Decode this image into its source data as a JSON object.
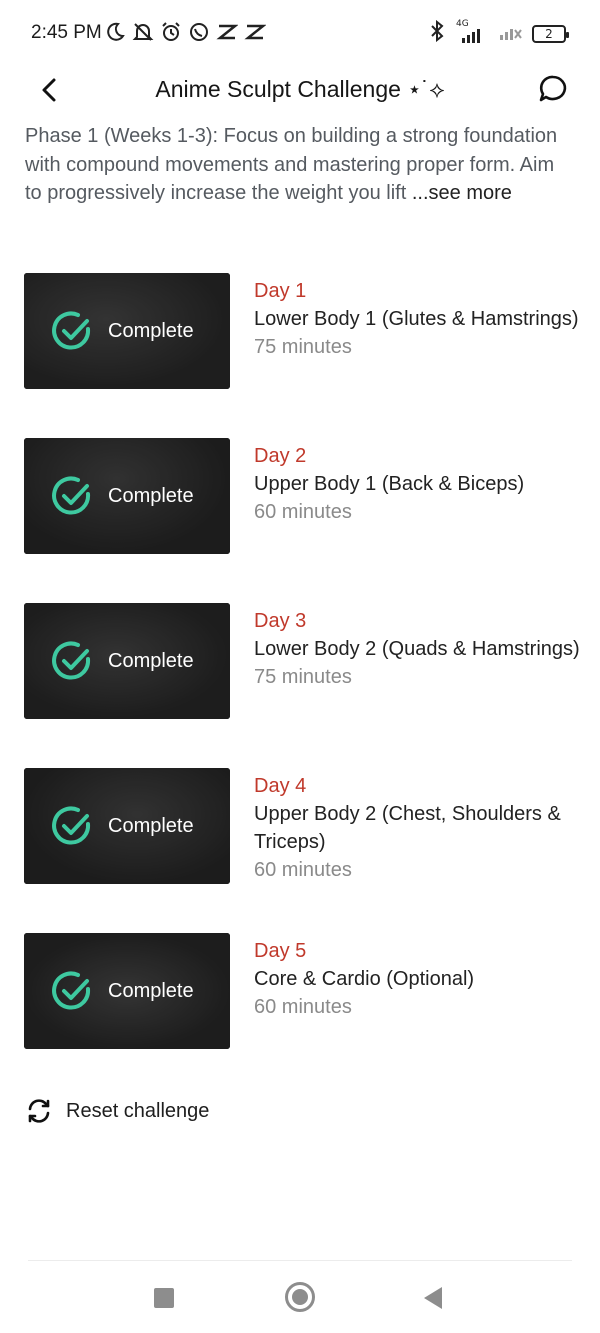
{
  "status_bar": {
    "time": "2:45 PM",
    "network": "4G",
    "battery": "2",
    "icons_left": [
      "moon-icon",
      "muted-bell-icon",
      "alarm-icon",
      "whatsapp-icon",
      "capcut-icon",
      "capcut-icon"
    ],
    "icons_right": [
      "bluetooth-icon",
      "signal-4g-icon",
      "signal-weak-icon",
      "battery-icon"
    ]
  },
  "header": {
    "title": "Anime Sculpt Challenge ⋆˙⟡",
    "back_icon": "chevron-left-icon",
    "chat_icon": "chat-bubble-icon"
  },
  "description": {
    "text": "Phase 1 (Weeks 1-3): Focus on building a strong foundation with compound movements and mastering proper form. Aim to progressively increase the weight you lift ",
    "see_more": "...see more"
  },
  "days": [
    {
      "day": "Day 1",
      "name": "Lower Body 1 (Glutes & Hamstrings)",
      "duration": "75 minutes",
      "status": "Complete"
    },
    {
      "day": "Day 2",
      "name": "Upper Body 1 (Back & Biceps)",
      "duration": "60 minutes",
      "status": "Complete"
    },
    {
      "day": "Day 3",
      "name": "Lower Body 2 (Quads & Hamstrings)",
      "duration": "75 minutes",
      "status": "Complete"
    },
    {
      "day": "Day 4",
      "name": "Upper Body 2 (Chest, Shoulders & Triceps)",
      "duration": "60 minutes",
      "status": "Complete"
    },
    {
      "day": "Day 5",
      "name": "Core & Cardio (Optional)",
      "duration": "60 minutes",
      "status": "Complete"
    }
  ],
  "reset": {
    "label": "Reset challenge",
    "icon": "refresh-icon"
  },
  "colors": {
    "accent_day": "#c0392b",
    "check": "#3ec9a0",
    "thumb_bg": "#2e2e2e"
  }
}
